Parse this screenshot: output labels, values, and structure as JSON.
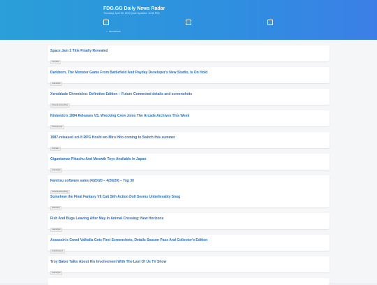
{
  "header": {
    "site_title": "FDG.GG Daily News Radar",
    "subtitle": "Thursday, April 30, 2020 (Last Updated: 11:55 PM)",
    "tag_label": "— Last Refresh"
  },
  "articles": [
    {
      "title": "Space Jam 2 Title Finally Revealed",
      "source": "Gematsu"
    },
    {
      "title": "Darkborn, The Monster Game From Battlefield And Payday Developer's New Studio, Is On Hold",
      "source": "GameSpot"
    },
    {
      "title": "Xenoblade Chronicles: Definitive Edition – Future Connected details and screenshots",
      "source": "Nintendo Everything"
    },
    {
      "title": "Nintendo's 1994 Releases VS. Wrecking Crew Joins The Arcade Archives This Week",
      "source": "Nintendo Life"
    },
    {
      "title": "1987-released sci-fi RPG Hoshi wo Miru Hito coming to Switch this summer",
      "source": "Gematsu"
    },
    {
      "title": "Gigantamax Pikachu And Meowth Toys Available In Japan",
      "source": "GameSpot"
    },
    {
      "title": "Famitsu software sales (4/20/20 – 4/26/20) – Top 30",
      "source": "Nintendo Everything"
    },
    {
      "title": "Somehow the Final Fantasy VII Cait Sith Action Doll Seems Unbelievably Snug",
      "source": "Siliconera"
    },
    {
      "title": "Fish And Bugs Leaving After May In Animal Crossing: New Horizons",
      "source": "GameSpot"
    },
    {
      "title": "Assassin's Creed Valhalla Gets First Screenshots, Details Season Pass And Collector's Edition",
      "source": "DualShockers"
    },
    {
      "title": "Troy Baker Talks About His Involvement With The Last Of Us TV Show",
      "source": "GameSpot"
    }
  ]
}
